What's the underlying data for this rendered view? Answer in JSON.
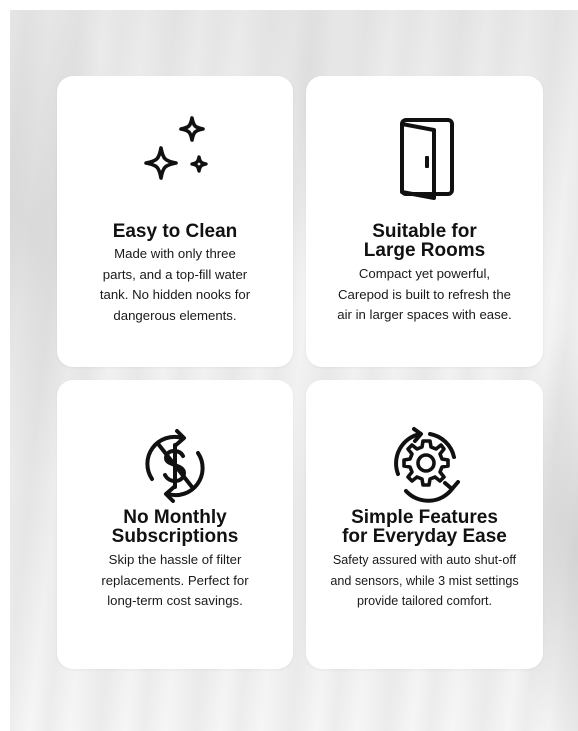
{
  "features": [
    {
      "icon": "sparkles-icon",
      "title_lines": [
        "Easy to Clean"
      ],
      "desc_lines": [
        "Made with only three",
        "parts, and a top-fill water",
        "tank. No hidden nooks for",
        "dangerous elements."
      ]
    },
    {
      "icon": "door-icon",
      "title_lines": [
        "Suitable for",
        "Large Rooms"
      ],
      "desc_lines": [
        "Compact yet powerful,",
        "Carepod is built to refresh the",
        "air in larger spaces with ease."
      ]
    },
    {
      "icon": "no-subscription-dollar-icon",
      "title_lines": [
        "No Monthly",
        "Subscriptions"
      ],
      "desc_lines": [
        "Skip the hassle of filter",
        "replacements. Perfect for",
        "long-term cost savings."
      ]
    },
    {
      "icon": "gear-cycle-icon",
      "title_lines": [
        "Simple Features",
        "for Everyday Ease"
      ],
      "desc_lines": [
        "Safety assured with auto shut-off",
        "and sensors, while 3 mist settings",
        "provide tailored comfort."
      ]
    }
  ],
  "colors": {
    "card_background": "#ffffff",
    "text": "#111111",
    "icon_stroke": "#111111"
  }
}
